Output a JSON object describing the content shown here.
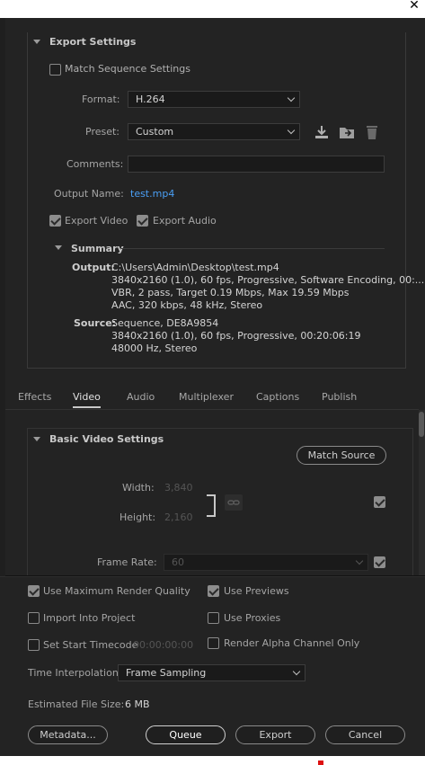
{
  "window": {
    "close_icon": "close-icon"
  },
  "export_settings": {
    "title": "Export Settings",
    "match_sequence": {
      "label": "Match Sequence Settings",
      "checked": false
    },
    "format": {
      "label": "Format:",
      "value": "H.264"
    },
    "preset": {
      "label": "Preset:",
      "value": "Custom"
    },
    "comments": {
      "label": "Comments:",
      "value": ""
    },
    "output_name": {
      "label": "Output Name:",
      "value": "test.mp4"
    },
    "export_video": {
      "label": "Export Video",
      "checked": true
    },
    "export_audio": {
      "label": "Export Audio",
      "checked": true
    },
    "summary": {
      "title": "Summary",
      "output_label": "Output:",
      "output_lines": [
        "C:\\Users\\Admin\\Desktop\\test.mp4",
        "3840x2160 (1.0), 60 fps, Progressive, Software Encoding, 00:...",
        "VBR, 2 pass, Target 0.19 Mbps, Max 19.59 Mbps",
        "AAC, 320 kbps, 48 kHz, Stereo"
      ],
      "source_label": "Source:",
      "source_lines": [
        "Sequence, DE8A9854",
        "3840x2160 (1.0), 60 fps, Progressive, 00:20:06:19",
        "48000 Hz, Stereo"
      ]
    }
  },
  "tabs": [
    "Effects",
    "Video",
    "Audio",
    "Multiplexer",
    "Captions",
    "Publish"
  ],
  "active_tab": "Video",
  "video": {
    "title": "Basic Video Settings",
    "match_source": "Match Source",
    "width_label": "Width:",
    "width_value": "3,840",
    "height_label": "Height:",
    "height_value": "2,160",
    "frame_rate_label": "Frame Rate:",
    "frame_rate_value": "60"
  },
  "bottom": {
    "max_render": {
      "label": "Use Maximum Render Quality",
      "checked": true
    },
    "use_previews": {
      "label": "Use Previews",
      "checked": true
    },
    "import_project": {
      "label": "Import Into Project",
      "checked": false
    },
    "use_proxies": {
      "label": "Use Proxies",
      "checked": false
    },
    "set_start_tc": {
      "label": "Set Start Timecode",
      "checked": false,
      "value": "00:00:00:00"
    },
    "render_alpha": {
      "label": "Render Alpha Channel Only",
      "checked": false
    },
    "time_interp": {
      "label": "Time Interpolation:",
      "value": "Frame Sampling"
    },
    "file_size": {
      "label": "Estimated File Size:",
      "value": "6 MB"
    },
    "buttons": {
      "metadata": "Metadata...",
      "queue": "Queue",
      "export": "Export",
      "cancel": "Cancel"
    }
  }
}
